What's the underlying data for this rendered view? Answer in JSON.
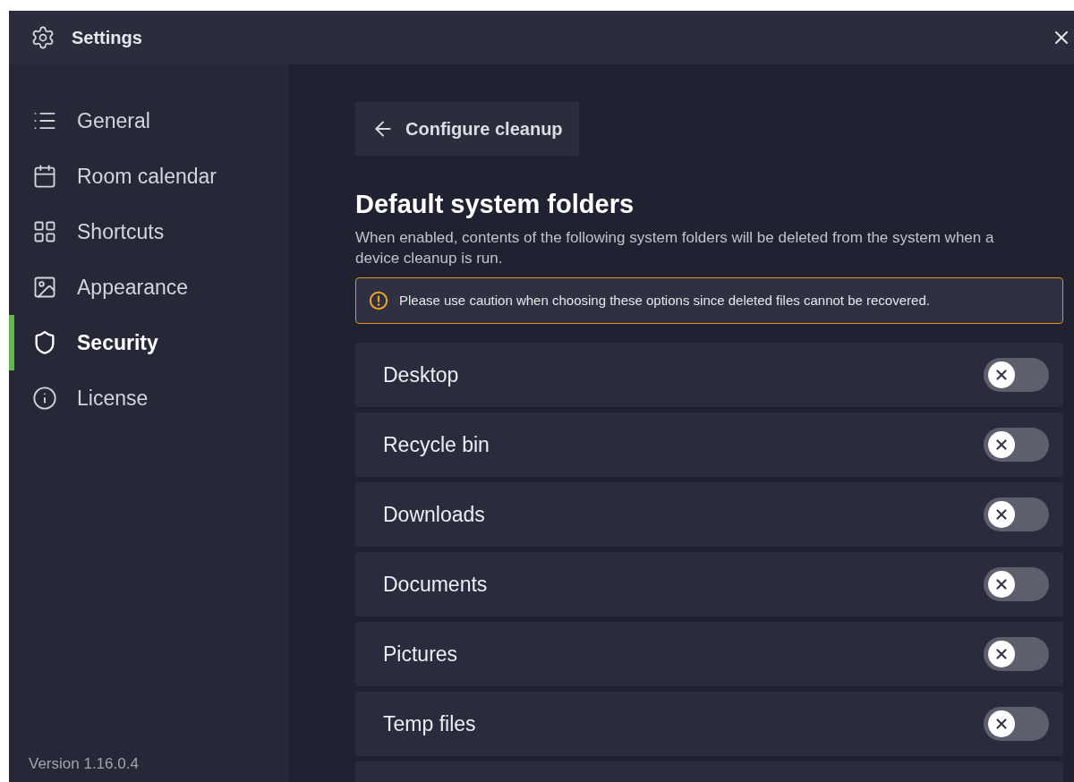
{
  "window": {
    "title": "Settings"
  },
  "sidebar": {
    "items": [
      {
        "label": "General",
        "kind": "list",
        "selected": false
      },
      {
        "label": "Room calendar",
        "kind": "calendar",
        "selected": false
      },
      {
        "label": "Shortcuts",
        "kind": "grid",
        "selected": false
      },
      {
        "label": "Appearance",
        "kind": "image",
        "selected": false
      },
      {
        "label": "Security",
        "kind": "shield",
        "selected": true
      },
      {
        "label": "License",
        "kind": "info",
        "selected": false
      }
    ],
    "version": "Version 1.16.0.4"
  },
  "content": {
    "back_button": "Configure cleanup",
    "heading": "Default system folders",
    "description": "When enabled, contents of the following system folders will be deleted from the system when a device cleanup is run.",
    "warning": "Please use caution when choosing these options since deleted files cannot be recovered.",
    "folders": [
      {
        "label": "Desktop",
        "on": false
      },
      {
        "label": "Recycle bin",
        "on": false
      },
      {
        "label": "Downloads",
        "on": false
      },
      {
        "label": "Documents",
        "on": false
      },
      {
        "label": "Pictures",
        "on": false
      },
      {
        "label": "Temp files",
        "on": false
      }
    ]
  }
}
